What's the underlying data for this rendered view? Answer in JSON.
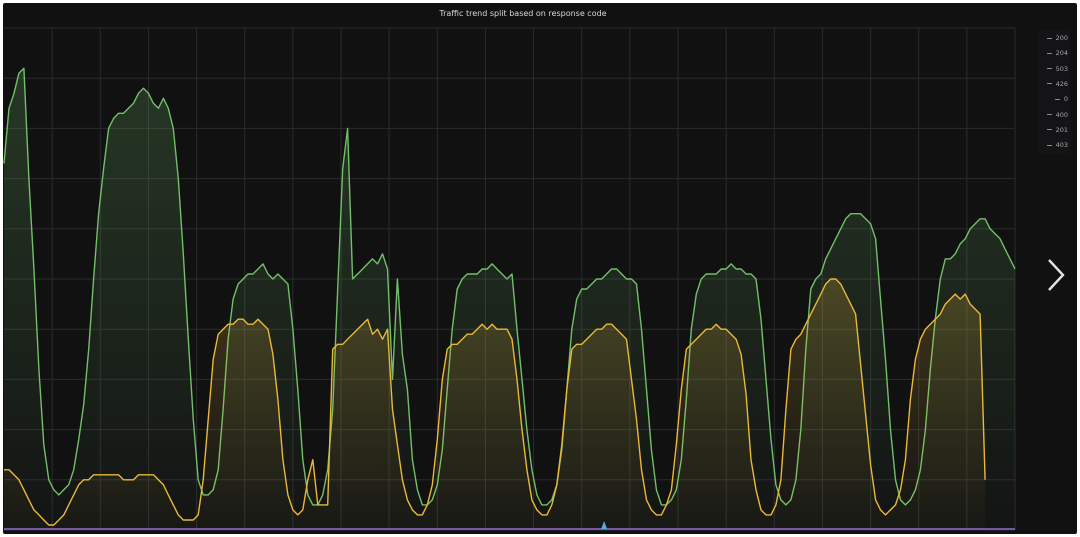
{
  "chart_data": {
    "type": "line",
    "title": "Traffic trend split based on response code",
    "xlabel": "",
    "ylabel": "",
    "x": [
      0,
      1,
      2,
      3,
      4,
      5,
      6,
      7,
      8,
      9,
      10,
      11,
      12,
      13,
      14,
      15,
      16,
      17,
      18,
      19,
      20,
      21,
      22,
      23,
      24,
      25,
      26,
      27,
      28,
      29,
      30,
      31,
      32,
      33,
      34,
      35,
      36,
      37,
      38,
      39,
      40,
      41,
      42,
      43,
      44,
      45,
      46,
      47,
      48,
      49,
      50,
      51,
      52,
      53,
      54,
      55,
      56,
      57,
      58,
      59,
      60,
      61,
      62,
      63,
      64,
      65,
      66,
      67,
      68,
      69,
      70,
      71,
      72,
      73,
      74,
      75,
      76,
      77,
      78,
      79,
      80,
      81,
      82,
      83,
      84,
      85,
      86,
      87,
      88,
      89,
      90,
      91,
      92,
      93,
      94,
      95,
      96,
      97,
      98,
      99,
      100,
      101,
      102,
      103,
      104,
      105,
      106,
      107,
      108,
      109,
      110,
      111,
      112,
      113,
      114,
      115,
      116,
      117,
      118,
      119,
      120,
      121,
      122,
      123,
      124,
      125,
      126,
      127,
      128,
      129,
      130,
      131,
      132,
      133,
      134,
      135,
      136,
      137,
      138,
      139,
      140,
      141,
      142,
      143,
      144,
      145,
      146,
      147,
      148,
      149,
      150,
      151,
      152,
      153,
      154,
      155,
      156,
      157,
      158,
      159,
      160,
      161,
      162,
      163,
      164,
      165,
      166,
      167,
      168,
      169,
      170,
      171,
      172,
      173,
      174,
      175,
      176,
      177,
      178,
      179,
      180,
      181,
      182,
      183,
      184,
      185,
      186,
      187,
      188,
      189,
      190,
      191,
      192,
      193,
      194,
      195,
      196,
      197,
      198,
      199,
      200,
      201,
      202,
      203
    ],
    "ylim": [
      0,
      100
    ],
    "xlim": [
      0,
      203
    ],
    "grid": true,
    "series": [
      {
        "name": "200",
        "color": "#73bf69",
        "values": [
          73,
          84,
          87,
          91,
          92,
          70,
          52,
          32,
          17,
          10,
          8,
          7,
          8,
          9,
          12,
          18,
          25,
          36,
          50,
          63,
          72,
          80,
          82,
          83,
          83,
          84,
          85,
          87,
          88,
          87,
          85,
          84,
          86,
          84,
          80,
          70,
          55,
          38,
          22,
          10,
          7,
          7,
          8,
          12,
          24,
          38,
          46,
          49,
          50,
          51,
          51,
          52,
          53,
          51,
          50,
          51,
          50,
          49,
          40,
          28,
          14,
          7,
          5,
          5,
          7,
          12,
          24,
          48,
          72,
          80,
          50,
          51,
          52,
          53,
          54,
          53,
          55,
          52,
          30,
          50,
          35,
          28,
          14,
          8,
          5,
          5,
          6,
          9,
          16,
          28,
          40,
          48,
          50,
          51,
          51,
          51,
          52,
          52,
          53,
          52,
          51,
          50,
          51,
          40,
          30,
          20,
          12,
          7,
          5,
          5,
          6,
          9,
          16,
          28,
          40,
          46,
          48,
          48,
          49,
          50,
          50,
          51,
          52,
          52,
          51,
          50,
          50,
          49,
          40,
          28,
          16,
          8,
          5,
          5,
          6,
          8,
          14,
          26,
          40,
          47,
          50,
          51,
          51,
          51,
          52,
          52,
          53,
          52,
          52,
          51,
          51,
          50,
          42,
          30,
          18,
          9,
          6,
          5,
          6,
          10,
          20,
          36,
          48,
          50,
          51,
          54,
          56,
          58,
          60,
          62,
          63,
          63,
          63,
          62,
          61,
          58,
          46,
          34,
          20,
          10,
          6,
          5,
          6,
          8,
          12,
          20,
          32,
          42,
          50,
          54,
          54,
          55,
          57,
          58,
          60,
          61,
          62,
          62,
          60,
          59,
          58,
          56,
          54,
          52
        ]
      },
      {
        "name": "204",
        "color": "#eab839",
        "values": [
          12,
          12,
          11,
          10,
          8,
          6,
          4,
          3,
          2,
          1,
          1,
          2,
          3,
          5,
          7,
          9,
          10,
          10,
          11,
          11,
          11,
          11,
          11,
          11,
          10,
          10,
          10,
          11,
          11,
          11,
          11,
          10,
          9,
          7,
          5,
          3,
          2,
          2,
          2,
          3,
          10,
          22,
          34,
          39,
          40,
          41,
          41,
          42,
          42,
          41,
          41,
          42,
          41,
          40,
          35,
          26,
          14,
          7,
          4,
          3,
          4,
          10,
          14,
          5,
          5,
          5,
          36,
          37,
          37,
          38,
          39,
          40,
          41,
          42,
          39,
          40,
          38,
          40,
          24,
          17,
          10,
          6,
          4,
          3,
          3,
          5,
          9,
          18,
          30,
          36,
          37,
          37,
          38,
          39,
          39,
          40,
          41,
          40,
          41,
          40,
          40,
          40,
          38,
          30,
          20,
          12,
          6,
          4,
          3,
          3,
          5,
          9,
          17,
          28,
          36,
          37,
          37,
          38,
          39,
          40,
          40,
          41,
          41,
          40,
          39,
          38,
          30,
          22,
          12,
          6,
          4,
          3,
          3,
          5,
          8,
          17,
          28,
          36,
          37,
          38,
          39,
          40,
          40,
          41,
          40,
          40,
          39,
          38,
          35,
          27,
          14,
          8,
          4,
          3,
          3,
          5,
          10,
          24,
          36,
          38,
          39,
          41,
          43,
          45,
          47,
          49,
          50,
          50,
          49,
          47,
          45,
          43,
          33,
          23,
          13,
          6,
          4,
          3,
          4,
          5,
          8,
          14,
          26,
          34,
          38,
          40,
          41,
          42,
          43,
          45,
          46,
          47,
          46,
          47,
          45,
          44,
          43,
          10
        ]
      }
    ],
    "legend_entries": [
      "200",
      "204",
      "503",
      "426",
      "0",
      "400",
      "201",
      "403"
    ],
    "legend_placement": "right",
    "flat_series_color": "#8f6bd1",
    "spike_color": "#5aa9e6"
  },
  "controls": {
    "next_icon": "chevron-right-icon"
  },
  "colors": {
    "background": "#111112",
    "grid": "#2a2b2e",
    "text": "#d8d9da"
  }
}
